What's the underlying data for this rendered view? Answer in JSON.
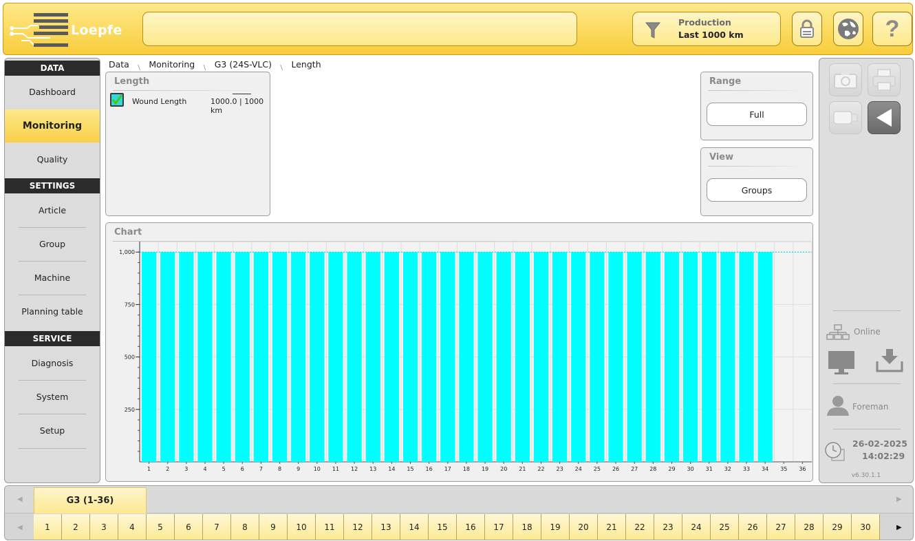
{
  "header": {
    "logo_text": "Loepfe",
    "filter_label": "Production",
    "filter_value": "Last 1000 km"
  },
  "nav": {
    "data_header": "DATA",
    "dashboard": "Dashboard",
    "monitoring": "Monitoring",
    "quality": "Quality",
    "settings_header": "SETTINGS",
    "article": "Article",
    "group": "Group",
    "machine": "Machine",
    "planning_table": "Planning table",
    "service_header": "SERVICE",
    "diagnosis": "Diagnosis",
    "system": "System",
    "setup": "Setup",
    "active": "Monitoring"
  },
  "breadcrumb": [
    "Data",
    "Monitoring",
    "G3 (24S-VLC)",
    "Length"
  ],
  "length_panel": {
    "title": "Length",
    "checked": true,
    "label": "Wound Length",
    "value": "1000.0 | 1000  km"
  },
  "range_panel": {
    "title": "Range",
    "button": "Full"
  },
  "view_panel": {
    "title": "View",
    "button": "Groups"
  },
  "chart_panel": {
    "title": "Chart"
  },
  "chart_data": {
    "type": "bar",
    "title": "",
    "xlabel": "",
    "ylabel": "",
    "categories": [
      "1",
      "2",
      "3",
      "4",
      "5",
      "6",
      "7",
      "8",
      "9",
      "10",
      "11",
      "12",
      "13",
      "14",
      "15",
      "16",
      "17",
      "18",
      "19",
      "20",
      "21",
      "22",
      "23",
      "24",
      "25",
      "26",
      "27",
      "28",
      "29",
      "30",
      "31",
      "32",
      "33",
      "34",
      "35",
      "36"
    ],
    "values": [
      1000,
      1000,
      1000,
      1000,
      1000,
      1000,
      1000,
      1000,
      1000,
      1000,
      1000,
      1000,
      1000,
      1000,
      1000,
      1000,
      1000,
      1000,
      1000,
      1000,
      1000,
      1000,
      1000,
      1000,
      1000,
      1000,
      1000,
      1000,
      1000,
      1000,
      1000,
      1000,
      1000,
      1000,
      0,
      0
    ],
    "yticks": [
      250,
      500,
      750,
      1000
    ],
    "ytick_labels": [
      "250",
      "500",
      "750",
      "1,000"
    ],
    "ylim": [
      0,
      1050
    ],
    "reference_line": 1000,
    "bar_color": "#00ffff",
    "grid": true,
    "legend": "none"
  },
  "right_panel": {
    "status": "Online",
    "user": "Foreman",
    "date": "26-02-2025",
    "time": "14:02:29",
    "version": "v6.30.1.1"
  },
  "bottom": {
    "group_tab": "G3 (1-36)",
    "spindles": [
      "1",
      "2",
      "3",
      "4",
      "5",
      "6",
      "7",
      "8",
      "9",
      "10",
      "11",
      "12",
      "13",
      "14",
      "15",
      "16",
      "17",
      "18",
      "19",
      "20",
      "21",
      "22",
      "23",
      "24",
      "25",
      "26",
      "27",
      "28",
      "29",
      "30"
    ]
  },
  "colors": {
    "accent_yellow": "#f9cd3c",
    "bar": "#00ffff",
    "checkbox": "#30d8d8"
  }
}
